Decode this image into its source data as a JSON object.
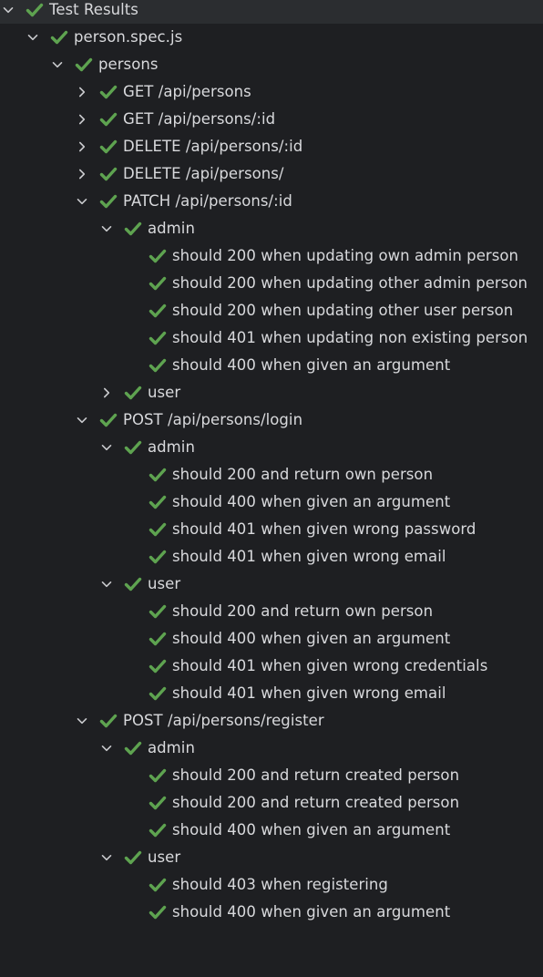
{
  "colors": {
    "background": "#1e1f22",
    "selected_row": "#2b2d30",
    "text": "#d8d9dc",
    "check_green": "#5ea350",
    "chevron": "#c9cacd"
  },
  "icons": {
    "passed": "check-icon",
    "expanded": "chevron-down-icon",
    "collapsed": "chevron-right-icon"
  },
  "tree": [
    {
      "label": "Test Results",
      "depth": 0,
      "state": "expanded",
      "status": "passed",
      "selected": true
    },
    {
      "label": "person.spec.js",
      "depth": 1,
      "state": "expanded",
      "status": "passed"
    },
    {
      "label": "persons",
      "depth": 2,
      "state": "expanded",
      "status": "passed"
    },
    {
      "label": "GET /api/persons",
      "depth": 3,
      "state": "collapsed",
      "status": "passed"
    },
    {
      "label": "GET /api/persons/:id",
      "depth": 3,
      "state": "collapsed",
      "status": "passed"
    },
    {
      "label": "DELETE /api/persons/:id",
      "depth": 3,
      "state": "collapsed",
      "status": "passed"
    },
    {
      "label": "DELETE /api/persons/",
      "depth": 3,
      "state": "collapsed",
      "status": "passed"
    },
    {
      "label": "PATCH /api/persons/:id",
      "depth": 3,
      "state": "expanded",
      "status": "passed"
    },
    {
      "label": "admin",
      "depth": 4,
      "state": "expanded",
      "status": "passed"
    },
    {
      "label": "should 200 when updating own admin person",
      "depth": 5,
      "state": "leaf",
      "status": "passed"
    },
    {
      "label": "should 200 when updating other admin person",
      "depth": 5,
      "state": "leaf",
      "status": "passed"
    },
    {
      "label": "should 200 when updating other user person",
      "depth": 5,
      "state": "leaf",
      "status": "passed"
    },
    {
      "label": "should 401 when updating non existing person",
      "depth": 5,
      "state": "leaf",
      "status": "passed"
    },
    {
      "label": "should 400 when given an argument",
      "depth": 5,
      "state": "leaf",
      "status": "passed"
    },
    {
      "label": "user",
      "depth": 4,
      "state": "collapsed",
      "status": "passed"
    },
    {
      "label": "POST /api/persons/login",
      "depth": 3,
      "state": "expanded",
      "status": "passed"
    },
    {
      "label": "admin",
      "depth": 4,
      "state": "expanded",
      "status": "passed"
    },
    {
      "label": "should 200 and return own person",
      "depth": 5,
      "state": "leaf",
      "status": "passed"
    },
    {
      "label": "should 400 when given an argument",
      "depth": 5,
      "state": "leaf",
      "status": "passed"
    },
    {
      "label": "should 401 when given wrong password",
      "depth": 5,
      "state": "leaf",
      "status": "passed"
    },
    {
      "label": "should 401 when given wrong email",
      "depth": 5,
      "state": "leaf",
      "status": "passed"
    },
    {
      "label": "user",
      "depth": 4,
      "state": "expanded",
      "status": "passed"
    },
    {
      "label": "should 200 and return own person",
      "depth": 5,
      "state": "leaf",
      "status": "passed"
    },
    {
      "label": "should 400 when given an argument",
      "depth": 5,
      "state": "leaf",
      "status": "passed"
    },
    {
      "label": "should 401 when given wrong credentials",
      "depth": 5,
      "state": "leaf",
      "status": "passed"
    },
    {
      "label": "should 401 when given wrong email",
      "depth": 5,
      "state": "leaf",
      "status": "passed"
    },
    {
      "label": "POST /api/persons/register",
      "depth": 3,
      "state": "expanded",
      "status": "passed"
    },
    {
      "label": "admin",
      "depth": 4,
      "state": "expanded",
      "status": "passed"
    },
    {
      "label": "should 200 and return created person",
      "depth": 5,
      "state": "leaf",
      "status": "passed"
    },
    {
      "label": "should 200 and return created person",
      "depth": 5,
      "state": "leaf",
      "status": "passed"
    },
    {
      "label": "should 400 when given an argument",
      "depth": 5,
      "state": "leaf",
      "status": "passed"
    },
    {
      "label": "user",
      "depth": 4,
      "state": "expanded",
      "status": "passed"
    },
    {
      "label": "should 403 when registering",
      "depth": 5,
      "state": "leaf",
      "status": "passed"
    },
    {
      "label": "should 400 when given an argument",
      "depth": 5,
      "state": "leaf",
      "status": "passed"
    }
  ]
}
